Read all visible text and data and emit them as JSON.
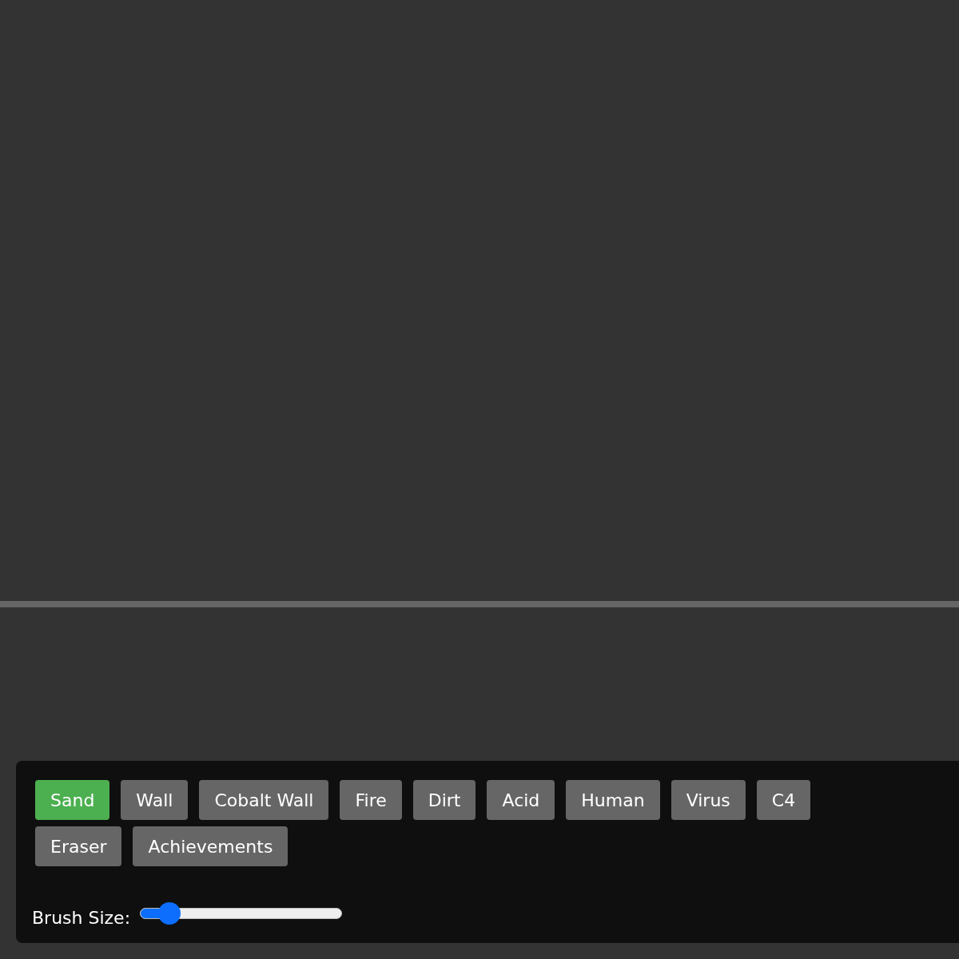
{
  "tools": [
    {
      "label": "Sand",
      "selected": true
    },
    {
      "label": "Wall",
      "selected": false
    },
    {
      "label": "Cobalt Wall",
      "selected": false
    },
    {
      "label": "Fire",
      "selected": false
    },
    {
      "label": "Dirt",
      "selected": false
    },
    {
      "label": "Acid",
      "selected": false
    },
    {
      "label": "Human",
      "selected": false
    },
    {
      "label": "Virus",
      "selected": false
    },
    {
      "label": "C4",
      "selected": false
    },
    {
      "label": "Eraser",
      "selected": false
    },
    {
      "label": "Achievements",
      "selected": false
    }
  ],
  "brush_size": {
    "label": "Brush Size:",
    "level": 0.1
  }
}
